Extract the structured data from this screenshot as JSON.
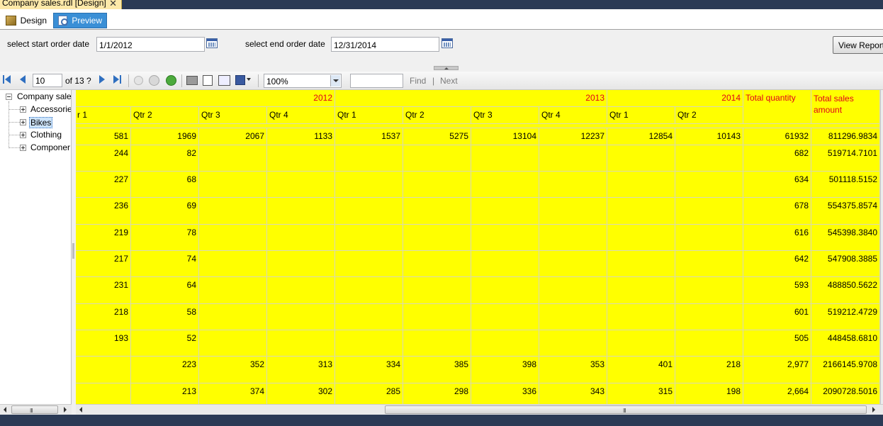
{
  "document_tab": {
    "title": "Company sales.rdl [Design]",
    "close_glyph": "✕"
  },
  "view_tabs": {
    "design": "Design",
    "preview": "Preview"
  },
  "parameters": {
    "start_label": "select start order date",
    "start_value": "1/1/2012",
    "end_label": "select end order date",
    "end_value": "12/31/2014",
    "view_report": "View Report"
  },
  "toolbar": {
    "page_value": "10",
    "of_text": "of  13 ?",
    "zoom": "100%",
    "find": "Find",
    "separator": "|",
    "next": "Next"
  },
  "tree": {
    "root": "Company sale",
    "children": [
      "Accessorie",
      "Bikes",
      "Clothing",
      "Componer"
    ]
  },
  "report": {
    "colors": {
      "cell_bg": "#ffff00",
      "header_text": "#e0001a"
    },
    "years": [
      "2012",
      "2013",
      "2014"
    ],
    "total_quantity": "Total quantity",
    "total_sales": "Total sales amount",
    "quarters": [
      "r 1",
      "Qtr 2",
      "Qtr 3",
      "Qtr 4",
      "Qtr 1",
      "Qtr 2",
      "Qtr 3",
      "Qtr 4",
      "Qtr 1",
      "Qtr 2"
    ],
    "rows": [
      [
        "581",
        "1969",
        "2067",
        "1133",
        "1537",
        "5275",
        "13104",
        "12237",
        "12854",
        "10143",
        "61932",
        "811296.9834"
      ],
      [
        "244",
        "82",
        "",
        "",
        "",
        "",
        "",
        "",
        "",
        "",
        "682",
        "519714.7101"
      ],
      [
        "227",
        "68",
        "",
        "",
        "",
        "",
        "",
        "",
        "",
        "",
        "634",
        "501118.5152"
      ],
      [
        "236",
        "69",
        "",
        "",
        "",
        "",
        "",
        "",
        "",
        "",
        "678",
        "554375.8574"
      ],
      [
        "219",
        "78",
        "",
        "",
        "",
        "",
        "",
        "",
        "",
        "",
        "616",
        "545398.3840"
      ],
      [
        "217",
        "74",
        "",
        "",
        "",
        "",
        "",
        "",
        "",
        "",
        "642",
        "547908.3885"
      ],
      [
        "231",
        "64",
        "",
        "",
        "",
        "",
        "",
        "",
        "",
        "",
        "593",
        "488850.5622"
      ],
      [
        "218",
        "58",
        "",
        "",
        "",
        "",
        "",
        "",
        "",
        "",
        "601",
        "519212.4729"
      ],
      [
        "193",
        "52",
        "",
        "",
        "",
        "",
        "",
        "",
        "",
        "",
        "505",
        "448458.6810"
      ],
      [
        "",
        "223",
        "352",
        "313",
        "334",
        "385",
        "398",
        "353",
        "401",
        "218",
        "2,977",
        "2166145.9708"
      ],
      [
        "",
        "213",
        "374",
        "302",
        "285",
        "298",
        "336",
        "343",
        "315",
        "198",
        "2,664",
        "2090728.5016"
      ]
    ]
  },
  "scrollbars": {
    "grip": "III"
  }
}
